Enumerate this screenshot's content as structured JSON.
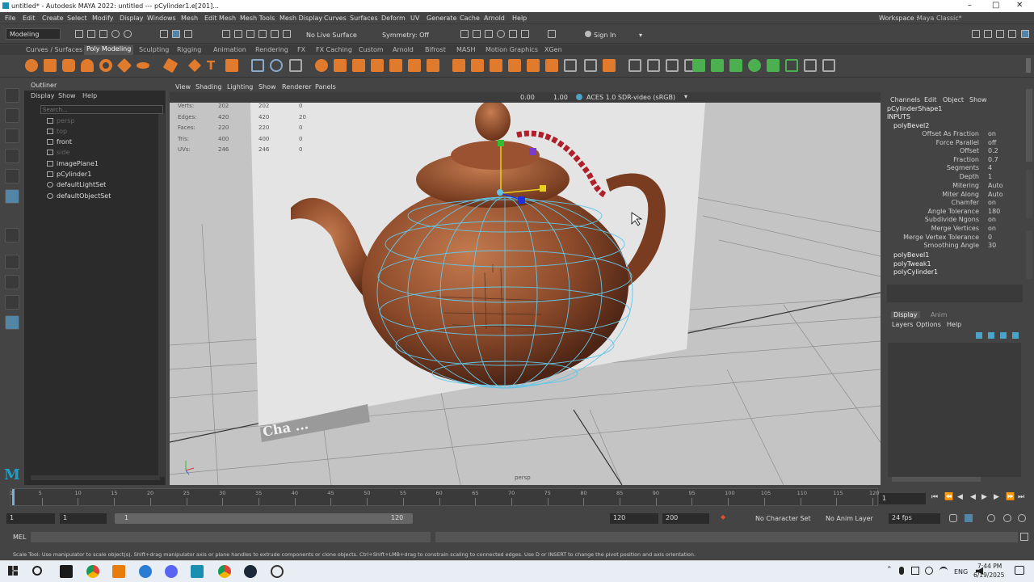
{
  "titlebar": {
    "title": "untitled* - Autodesk MAYA 2022: untitled   ---   pCylinder1.e[201]..."
  },
  "menus": [
    "File",
    "Edit",
    "Create",
    "Select",
    "Modify",
    "Display",
    "Windows",
    "Mesh",
    "Edit Mesh",
    "Mesh Tools",
    "Mesh Display",
    "Curves",
    "Surfaces",
    "Deform",
    "UV",
    "Generate",
    "Cache",
    "Arnold",
    "Help"
  ],
  "workspace": {
    "label": "Workspace :",
    "value": "Maya Classic*"
  },
  "statusline": {
    "mode": "Modeling",
    "live_surface": "No Live Surface",
    "symmetry": "Symmetry: Off",
    "sign_in": "Sign In"
  },
  "shelf_tabs": [
    "Curves / Surfaces",
    "Poly Modeling",
    "Sculpting",
    "Rigging",
    "Animation",
    "Rendering",
    "FX",
    "FX Caching",
    "Custom",
    "Arnold",
    "Bifrost",
    "MASH",
    "Motion Graphics",
    "XGen"
  ],
  "shelf_active": "Poly Modeling",
  "outliner": {
    "title": "Outliner",
    "menus": [
      "Display",
      "Show",
      "Help"
    ],
    "search_placeholder": "Search...",
    "items": [
      "persp",
      "top",
      "front",
      "side",
      "imagePlane1",
      "pCylinder1",
      "defaultLightSet",
      "defaultObjectSet"
    ]
  },
  "viewport": {
    "menus": [
      "View",
      "Shading",
      "Lighting",
      "Show",
      "Renderer",
      "Panels"
    ],
    "exposure": "0.00",
    "gamma": "1.00",
    "colorspace": "ACES 1.0 SDR-video (sRGB)",
    "camera": "persp",
    "watermark": "Cha ..."
  },
  "hud": {
    "rows": [
      {
        "label": "Verts:",
        "a": "202",
        "b": "202",
        "c": "0"
      },
      {
        "label": "Edges:",
        "a": "420",
        "b": "420",
        "c": "20"
      },
      {
        "label": "Faces:",
        "a": "220",
        "b": "220",
        "c": "0"
      },
      {
        "label": "Tris:",
        "a": "400",
        "b": "400",
        "c": "0"
      },
      {
        "label": "UVs:",
        "a": "246",
        "b": "246",
        "c": "0"
      }
    ]
  },
  "channelbox": {
    "menus": [
      "Channels",
      "Edit",
      "Object",
      "Show"
    ],
    "object": "pCylinderShape1",
    "inputs_label": "INPUTS",
    "node": "polyBevel2",
    "attrs": [
      {
        "k": "Offset As Fraction",
        "v": "on"
      },
      {
        "k": "Force Parallel",
        "v": "off"
      },
      {
        "k": "Offset",
        "v": "0.2"
      },
      {
        "k": "Fraction",
        "v": "0.7"
      },
      {
        "k": "Segments",
        "v": "4"
      },
      {
        "k": "Depth",
        "v": "1"
      },
      {
        "k": "Mitering",
        "v": "Auto"
      },
      {
        "k": "Miter Along",
        "v": "Auto"
      },
      {
        "k": "Chamfer",
        "v": "on"
      },
      {
        "k": "Angle Tolerance",
        "v": "180"
      },
      {
        "k": "Subdivide Ngons",
        "v": "on"
      },
      {
        "k": "Merge Vertices",
        "v": "on"
      },
      {
        "k": "Merge Vertex Tolerance",
        "v": "0"
      },
      {
        "k": "Smoothing Angle",
        "v": "30"
      }
    ],
    "nodes": [
      "polyBevel1",
      "polyTweak1",
      "polyCylinder1"
    ]
  },
  "layers": {
    "tabs": [
      "Display",
      "Anim"
    ],
    "menus": [
      "Layers",
      "Options",
      "Help"
    ]
  },
  "time": {
    "ticks": [
      "1",
      "5",
      "10",
      "15",
      "20",
      "25",
      "30",
      "35",
      "40",
      "45",
      "50",
      "55",
      "60",
      "65",
      "70",
      "75",
      "80",
      "85",
      "90",
      "95",
      "100",
      "105",
      "110",
      "115",
      "120"
    ],
    "current": "1",
    "start": "1",
    "start2": "1",
    "slider_start": "1",
    "slider_end": "120",
    "end": "120",
    "end2": "200",
    "char_set": "No Character Set",
    "anim_layer": "No Anim Layer",
    "fps": "24 fps"
  },
  "cmd": {
    "label": "MEL"
  },
  "helpline": "Scale Tool: Use manipulator to scale object(s). Shift+drag manipulator axis or plane handles to extrude components or clone objects. Ctrl+Shift+LMB+drag to constrain scaling to connected edges. Use D or INSERT to change the pivot position and axis orientation.",
  "taskbar": {
    "lang": "ENG",
    "time": "7:44 PM",
    "date": "6/19/2025"
  },
  "colors": {
    "accent": "#5285a6",
    "wire": "#63c5e6"
  }
}
